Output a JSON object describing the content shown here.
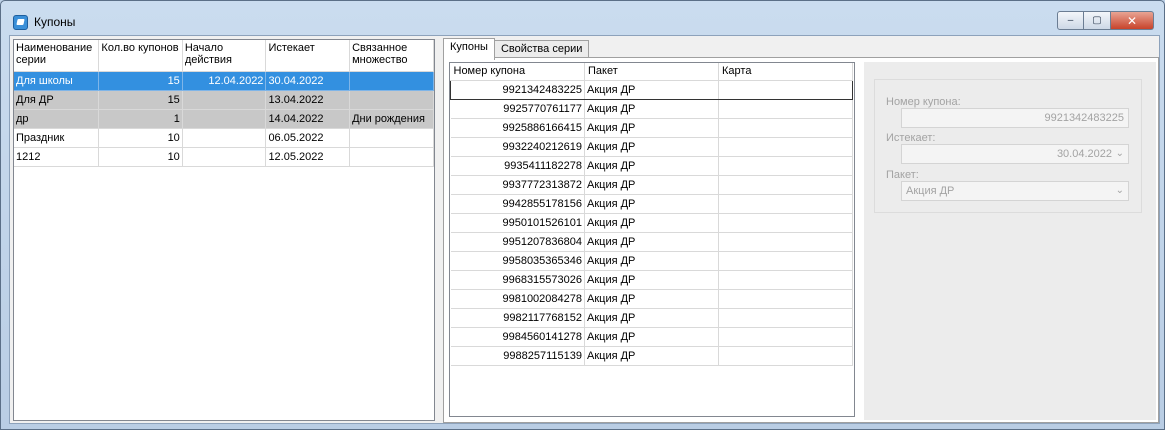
{
  "window": {
    "title": "Купоны"
  },
  "series_grid": {
    "columns": [
      "Наименование серии",
      "Кол.во купонов",
      "Начало действия",
      "Истекает",
      "Связанное множество"
    ],
    "rows": [
      {
        "name": "Для школы",
        "count": "15",
        "start": "12.04.2022",
        "expires": "30.04.2022",
        "set": ""
      },
      {
        "name": "Для ДР",
        "count": "15",
        "start": "",
        "expires": "13.04.2022",
        "set": ""
      },
      {
        "name": "др",
        "count": "1",
        "start": "",
        "expires": "14.04.2022",
        "set": "Дни рождения"
      },
      {
        "name": "Праздник",
        "count": "10",
        "start": "",
        "expires": "06.05.2022",
        "set": ""
      },
      {
        "name": "1212",
        "count": "10",
        "start": "",
        "expires": "12.05.2022",
        "set": ""
      }
    ]
  },
  "tabs": [
    "Купоны",
    "Свойства серии"
  ],
  "coupon_grid": {
    "columns": [
      "Номер купона",
      "Пакет",
      "Карта"
    ],
    "rows": [
      {
        "number": "9921342483225",
        "package": "Акция ДР",
        "card": ""
      },
      {
        "number": "9925770761177",
        "package": "Акция ДР",
        "card": ""
      },
      {
        "number": "9925886166415",
        "package": "Акция ДР",
        "card": ""
      },
      {
        "number": "9932240212619",
        "package": "Акция ДР",
        "card": ""
      },
      {
        "number": "9935411182278",
        "package": "Акция ДР",
        "card": ""
      },
      {
        "number": "9937772313872",
        "package": "Акция ДР",
        "card": ""
      },
      {
        "number": "9942855178156",
        "package": "Акция ДР",
        "card": ""
      },
      {
        "number": "9950101526101",
        "package": "Акция ДР",
        "card": ""
      },
      {
        "number": "9951207836804",
        "package": "Акция ДР",
        "card": ""
      },
      {
        "number": "9958035365346",
        "package": "Акция ДР",
        "card": ""
      },
      {
        "number": "9968315573026",
        "package": "Акция ДР",
        "card": ""
      },
      {
        "number": "9981002084278",
        "package": "Акция ДР",
        "card": ""
      },
      {
        "number": "9982117768152",
        "package": "Акция ДР",
        "card": ""
      },
      {
        "number": "9984560141278",
        "package": "Акция ДР",
        "card": ""
      },
      {
        "number": "9988257115139",
        "package": "Акция ДР",
        "card": ""
      }
    ]
  },
  "details": {
    "coupon_number_label": "Номер купона:",
    "coupon_number_value": "9921342483225",
    "expires_label": "Истекает:",
    "expires_value": "30.04.2022",
    "package_label": "Пакет:",
    "package_value": "Акция ДР"
  },
  "colors": {
    "selection": "#3390e0",
    "gray_row": "#c8c8c8"
  }
}
